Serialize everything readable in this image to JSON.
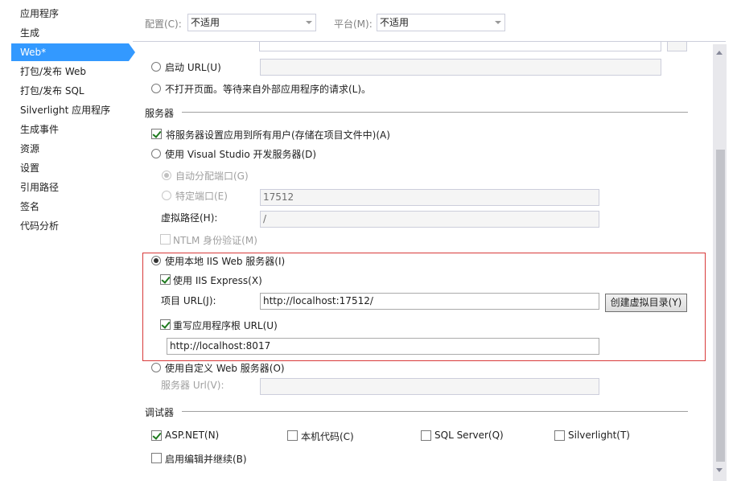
{
  "sidebar": {
    "items": [
      {
        "label": "应用程序"
      },
      {
        "label": "生成"
      },
      {
        "label": "Web*",
        "active": true
      },
      {
        "label": "打包/发布 Web"
      },
      {
        "label": "打包/发布 SQL"
      },
      {
        "label": "Silverlight 应用程序"
      },
      {
        "label": "生成事件"
      },
      {
        "label": "资源"
      },
      {
        "label": "设置"
      },
      {
        "label": "引用路径"
      },
      {
        "label": "签名"
      },
      {
        "label": "代码分析"
      }
    ]
  },
  "config_bar": {
    "config_label": "配置(C):",
    "config_value": "不适用",
    "platform_label": "平台(M):",
    "platform_value": "不适用"
  },
  "start_action": {
    "start_url_label": "启动 URL(U)",
    "start_url_value": "",
    "dont_open_label": "不打开页面。等待来自外部应用程序的请求(L)。"
  },
  "servers": {
    "section_title": "服务器",
    "apply_all_users_label": "将服务器设置应用到所有用户(存储在项目文件中)(A)",
    "apply_all_users_checked": true,
    "vs_dev_server_label": "使用 Visual Studio 开发服务器(D)",
    "auto_port_label": "自动分配端口(G)",
    "specific_port_label": "特定端口(E)",
    "specific_port_value": "17512",
    "virtual_path_label": "虚拟路径(H):",
    "virtual_path_value": "/",
    "ntlm_label": "NTLM 身份验证(M)",
    "local_iis_label": "使用本地 IIS Web 服务器(I)",
    "use_iis_express_label": "使用 IIS Express(X)",
    "use_iis_express_checked": true,
    "project_url_label": "项目 URL(J):",
    "project_url_value": "http://localhost:17512/",
    "create_vdir_label": "创建虚拟目录(Y)",
    "override_root_label": "重写应用程序根 URL(U)",
    "override_root_checked": true,
    "override_root_value": "http://localhost:8017",
    "custom_server_label": "使用自定义 Web 服务器(O)",
    "server_url_label": "服务器 Url(V):",
    "server_url_value": ""
  },
  "debuggers": {
    "section_title": "调试器",
    "aspnet_label": "ASP.NET(N)",
    "aspnet_checked": true,
    "native_label": "本机代码(C)",
    "sql_label": "SQL Server(Q)",
    "silverlight_label": "Silverlight(T)",
    "edit_continue_label": "启用编辑并继续(B)"
  },
  "colors": {
    "accent": "#3399ff",
    "highlight_border": "#d83a3a"
  }
}
